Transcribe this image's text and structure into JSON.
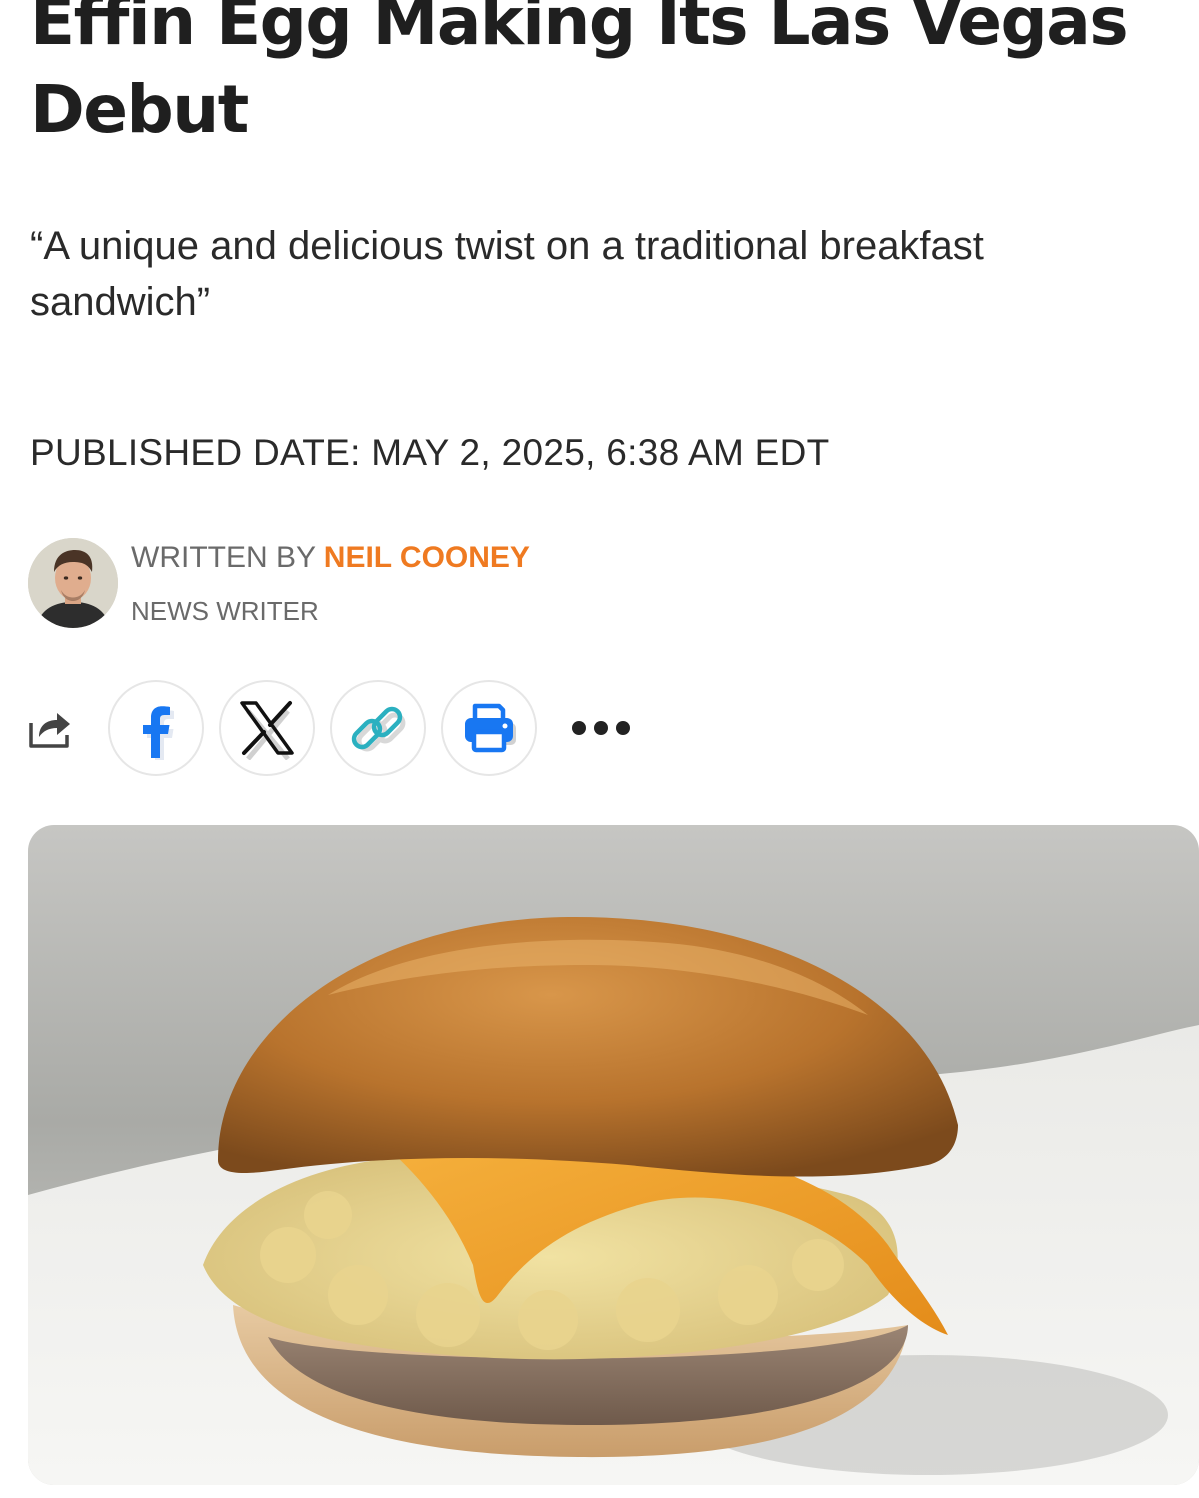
{
  "article": {
    "headline": "Effin Egg Making Its Las Vegas Debut",
    "subheadline": "“A unique and delicious twist on a traditional breakfast sandwich”",
    "published": "PUBLISHED DATE: MAY 2, 2025, 6:38 AM EDT"
  },
  "author": {
    "prefix": "WRITTEN BY ",
    "name": "NEIL COONEY",
    "role": "NEWS WRITER"
  },
  "share": {
    "buttons": [
      "share-icon",
      "facebook-icon",
      "x-icon",
      "link-icon",
      "print-icon",
      "more-icon"
    ]
  },
  "colors": {
    "accent": "#ef7a21",
    "facebook": "#1877f2",
    "link": "#2bb0c0",
    "print": "#1877f2"
  }
}
